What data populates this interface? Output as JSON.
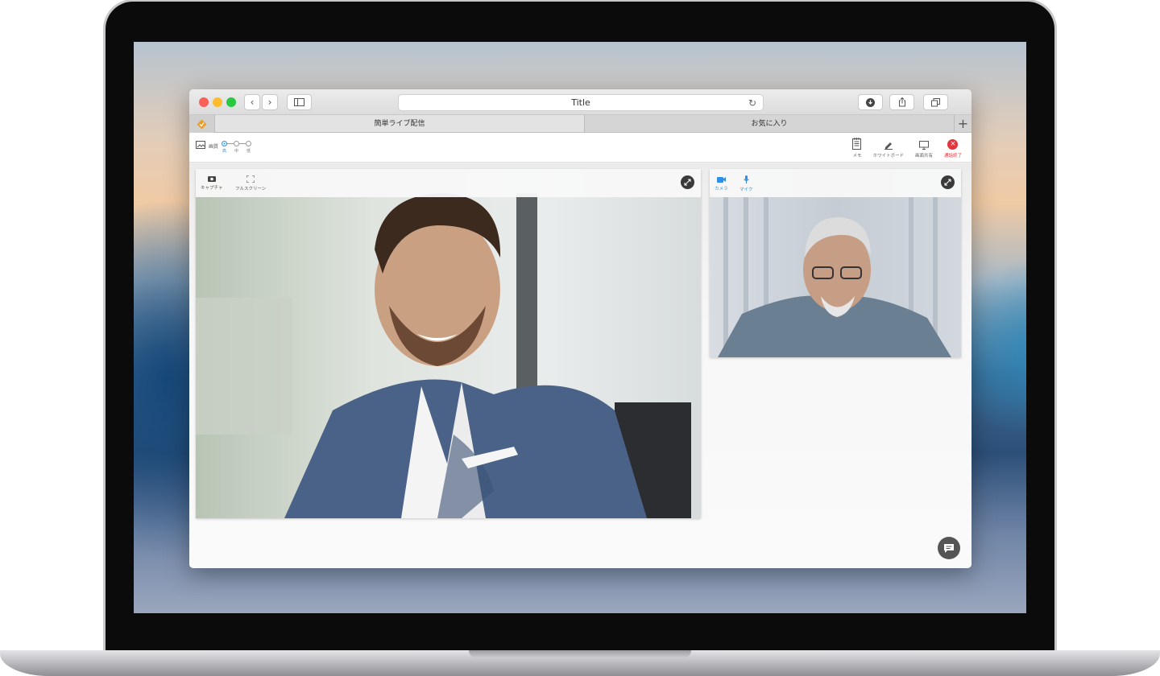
{
  "browser": {
    "address_title": "Title",
    "tabs": [
      {
        "label": "簡単ライブ配信",
        "active": true
      },
      {
        "label": "お気に入り",
        "active": false
      }
    ],
    "new_tab_symbol": "+"
  },
  "toolbar": {
    "quality_label": "画質",
    "quality_levels": [
      "高",
      "中",
      "低"
    ],
    "quality_selected": "高",
    "memo_label": "メモ",
    "whiteboard_label": "ホワイトボード",
    "screen_share_label": "画面共有",
    "end_call_label": "通話終了"
  },
  "main_video": {
    "capture_label": "キャプチャ",
    "fullscreen_label": "フルスクリーン"
  },
  "side_video": {
    "camera_label": "カメラ",
    "mic_label": "マイク"
  },
  "colors": {
    "accent": "#2d8fe8",
    "danger": "#e5333c",
    "logo": "#f29b21"
  },
  "icons": [
    "back-icon",
    "forward-icon",
    "sidebar-icon",
    "reload-icon",
    "download-icon",
    "share-icon",
    "tabs-icon",
    "logo-icon",
    "quality-icon",
    "memo-icon",
    "whiteboard-icon",
    "screen-share-icon",
    "end-call-icon",
    "capture-icon",
    "fullscreen-icon",
    "expand-icon",
    "camera-icon",
    "mic-icon",
    "chat-icon"
  ]
}
